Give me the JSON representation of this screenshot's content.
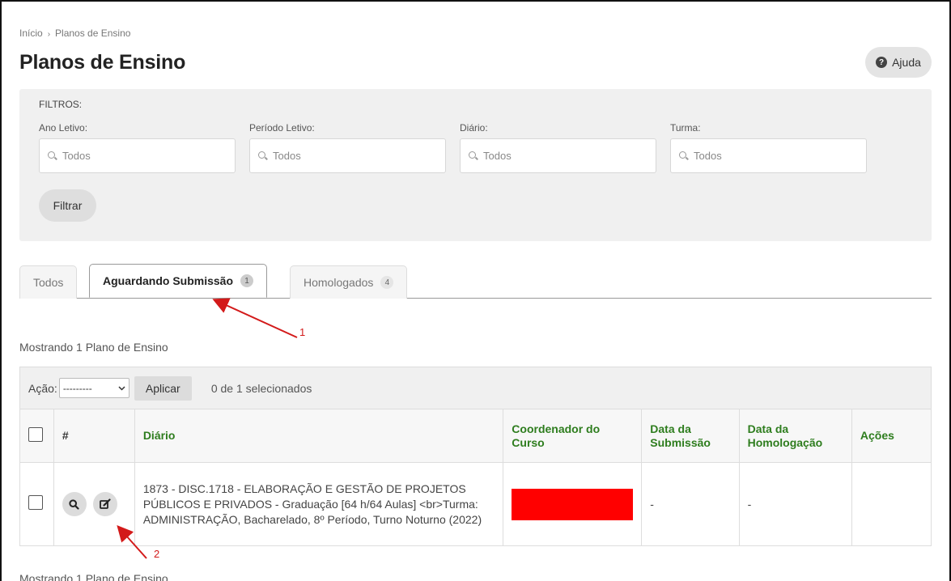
{
  "breadcrumb": {
    "home": "Início",
    "separator": "›",
    "current": "Planos de Ensino"
  },
  "page": {
    "title": "Planos de Ensino"
  },
  "help": {
    "label": "Ajuda",
    "icon": "question-circle-icon"
  },
  "filters": {
    "heading": "FILTROS:",
    "fields": [
      {
        "label": "Ano Letivo:",
        "value": "Todos"
      },
      {
        "label": "Período Letivo:",
        "value": "Todos"
      },
      {
        "label": "Diário:",
        "value": "Todos"
      },
      {
        "label": "Turma:",
        "value": "Todos"
      }
    ],
    "submit_label": "Filtrar"
  },
  "tabs": [
    {
      "label": "Todos",
      "active": false
    },
    {
      "label": "Aguardando Submissão",
      "count": "1",
      "active": true
    },
    {
      "label": "Homologados",
      "count": "4",
      "active": false
    }
  ],
  "results": {
    "showing": "Mostrando 1 Plano de Ensino"
  },
  "actions": {
    "label": "Ação:",
    "select_value": "---------",
    "apply_label": "Aplicar",
    "selected_count": "0 de 1 selecionados"
  },
  "table": {
    "headers": {
      "index": "#",
      "diario": "Diário",
      "coordenador": "Coordenador do Curso",
      "submissao": "Data da Submissão",
      "homologacao": "Data da Homologação",
      "acoes": "Ações"
    },
    "rows": [
      {
        "diario": "1873 - DISC.1718 - ELABORAÇÃO E GESTÃO DE PROJETOS PÚBLICOS E PRIVADOS - Graduação [64 h/64 Aulas] <br>Turma: ADMINISTRAÇÃO, Bacharelado, 8º Período, Turno Noturno (2022)",
        "data_submissao": "-",
        "data_homologacao": "-"
      }
    ]
  },
  "annotations": {
    "one": "1",
    "two": "2"
  },
  "colors": {
    "header_text": "#2e7d1e",
    "annotation": "#d31a1a",
    "redaction": "#ff0000"
  }
}
